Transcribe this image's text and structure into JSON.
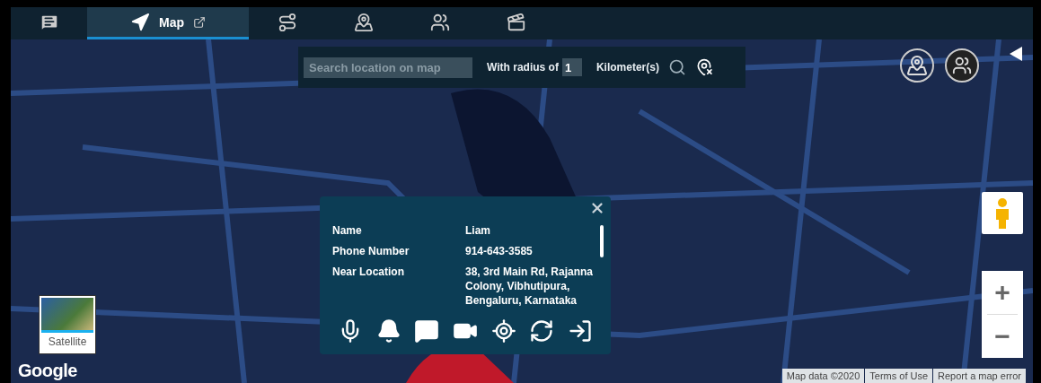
{
  "tabs": [
    {
      "kind": "chat",
      "selected": false
    },
    {
      "kind": "map",
      "label": "Map",
      "selected": true
    },
    {
      "kind": "route",
      "selected": false
    },
    {
      "kind": "zone",
      "selected": false
    },
    {
      "kind": "group",
      "selected": false
    },
    {
      "kind": "video",
      "selected": false
    }
  ],
  "search": {
    "placeholder": "Search location on map",
    "radius_label": "With radius of",
    "radius": "1",
    "unit": "Kilometer(s)"
  },
  "popup": {
    "rows": [
      {
        "label": "Name",
        "value": "Liam"
      },
      {
        "label": "Phone Number",
        "value": "914-643-3585"
      },
      {
        "label": "Near Location",
        "value": "38, 3rd Main Rd, Rajanna Colony, Vibhutipura, Bengaluru, Karnataka"
      }
    ],
    "actions": [
      {
        "kind": "mic"
      },
      {
        "kind": "alert"
      },
      {
        "kind": "message"
      },
      {
        "kind": "video"
      },
      {
        "kind": "track"
      },
      {
        "kind": "replay"
      },
      {
        "kind": "enter"
      }
    ]
  },
  "map_type": {
    "label": "Satellite"
  },
  "zoom": {
    "in": "+",
    "out": "−"
  },
  "logo": "Google",
  "footer": [
    "Map data ©2020",
    "Terms of Use",
    "Report a map error"
  ]
}
